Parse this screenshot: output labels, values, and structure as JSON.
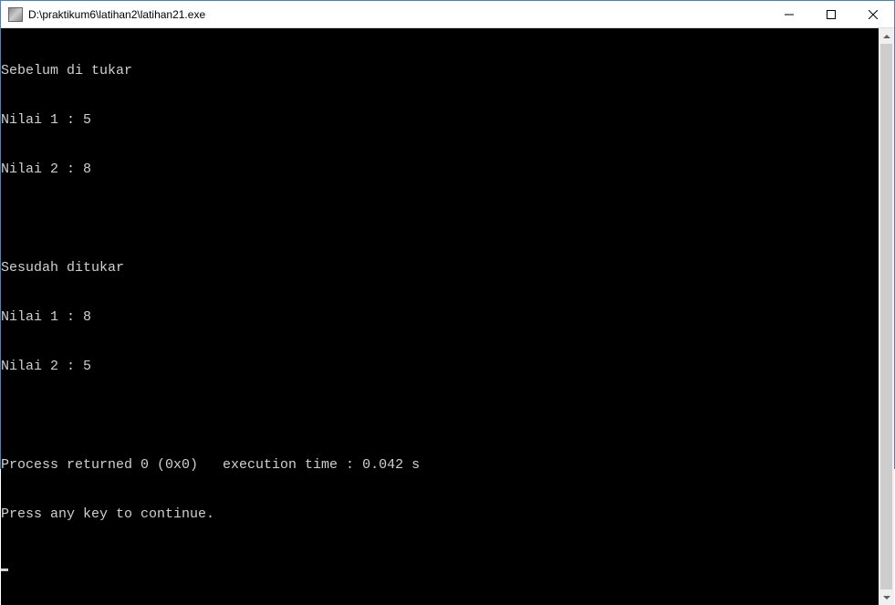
{
  "window": {
    "title": "D:\\praktikum6\\latihan2\\latihan21.exe"
  },
  "console": {
    "lines": [
      "Sebelum di tukar",
      "Nilai 1 : 5",
      "Nilai 2 : 8",
      "",
      "Sesudah ditukar",
      "Nilai 1 : 8",
      "Nilai 2 : 5",
      "",
      "Process returned 0 (0x0)   execution time : 0.042 s",
      "Press any key to continue."
    ]
  }
}
